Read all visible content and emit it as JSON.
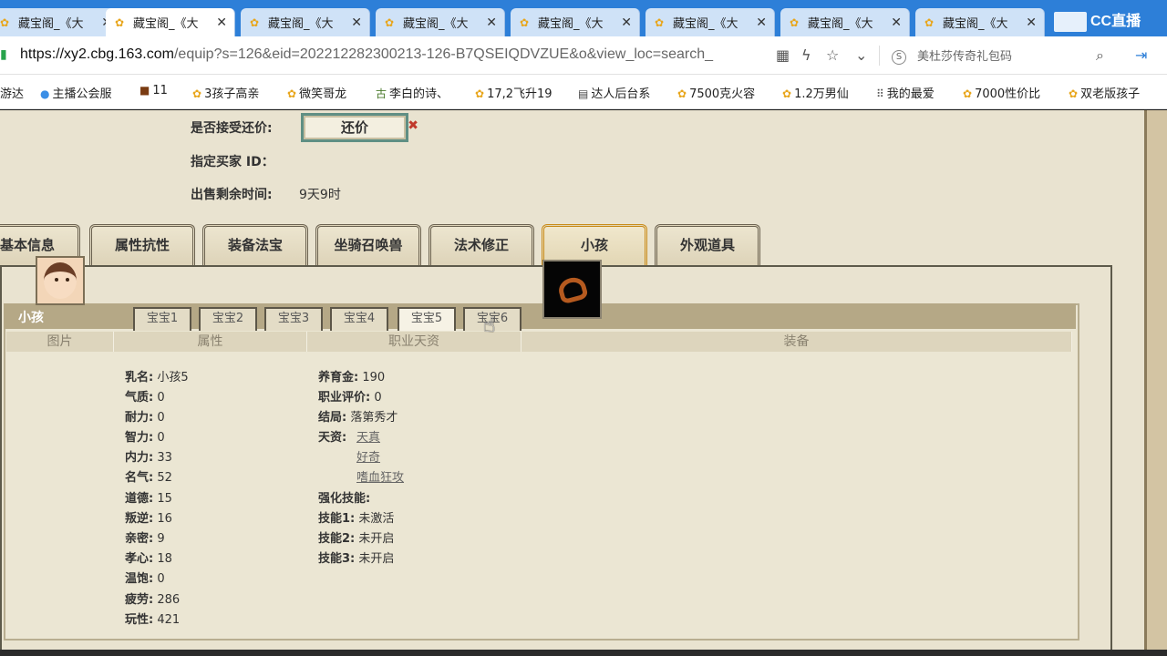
{
  "browser": {
    "tabs": [
      {
        "label": "藏宝阁_《大",
        "active": false
      },
      {
        "label": "藏宝阁_《大",
        "active": true
      },
      {
        "label": "藏宝阁_《大",
        "active": false
      },
      {
        "label": "藏宝阁_《大",
        "active": false
      },
      {
        "label": "藏宝阁_《大",
        "active": false
      },
      {
        "label": "藏宝阁_《大",
        "active": false
      },
      {
        "label": "藏宝阁_《大",
        "active": false
      },
      {
        "label": "藏宝阁_《大",
        "active": false
      }
    ],
    "tab_close": "✕",
    "extension_label": "CC直播",
    "url_host": "https://xy2.cbg.163.com",
    "url_path": "/equip?s=126&eid=202212282300213-126-B7QSEIQDVZUE&o&view_loc=search_",
    "search_placeholder": "美杜莎传奇礼包码",
    "bookmarks": [
      "游达",
      "主播公会服",
      "11",
      "3孩子高亲",
      "微笑哥龙",
      "李白的诗、",
      "17,2飞升19",
      "达人后台系",
      "7500克火容",
      "1.2万男仙",
      "我的最爱",
      "7000性价比",
      "双老版孩子"
    ]
  },
  "trade": {
    "accept_counter_label": "是否接受还价:",
    "counter_button": "还价",
    "buyer_id_label": "指定买家 ID：",
    "remaining_label": "出售剩余时间:",
    "remaining_value": "9天9时"
  },
  "section_tabs": [
    "基本信息",
    "属性抗性",
    "装备法宝",
    "坐骑召唤兽",
    "法术修正",
    "小孩",
    "外观道具"
  ],
  "active_section": "小孩",
  "kid": {
    "title": "小孩",
    "subtabs": [
      "宝宝1",
      "宝宝2",
      "宝宝3",
      "宝宝4",
      "宝宝5",
      "宝宝6"
    ],
    "active_subtab": "宝宝5",
    "columns": [
      "图片",
      "属性",
      "职业天资",
      "装备"
    ],
    "attributes": [
      {
        "k": "乳名:",
        "v": "小孩5"
      },
      {
        "k": "气质:",
        "v": "0"
      },
      {
        "k": "耐力:",
        "v": "0"
      },
      {
        "k": "智力:",
        "v": "0"
      },
      {
        "k": "内力:",
        "v": "33"
      },
      {
        "k": "名气:",
        "v": "52"
      },
      {
        "k": "道德:",
        "v": "15"
      },
      {
        "k": "叛逆:",
        "v": "16"
      },
      {
        "k": "亲密:",
        "v": "9"
      },
      {
        "k": "孝心:",
        "v": "18"
      },
      {
        "k": "温饱:",
        "v": "0"
      },
      {
        "k": "疲劳:",
        "v": "286"
      },
      {
        "k": "玩性:",
        "v": "421"
      }
    ],
    "job": {
      "raise_gold_k": "养育金:",
      "raise_gold_v": "190",
      "rating_k": "职业评价:",
      "rating_v": "0",
      "ending_k": "结局:",
      "ending_v": "落第秀才",
      "talent_k": "天资:",
      "talents": [
        "天真",
        "好奇",
        "嗜血狂攻"
      ],
      "enhance_k": "强化技能:",
      "skills": [
        {
          "k": "技能1:",
          "v": "未激活"
        },
        {
          "k": "技能2:",
          "v": "未开启"
        },
        {
          "k": "技能3:",
          "v": "未开启"
        }
      ]
    }
  }
}
